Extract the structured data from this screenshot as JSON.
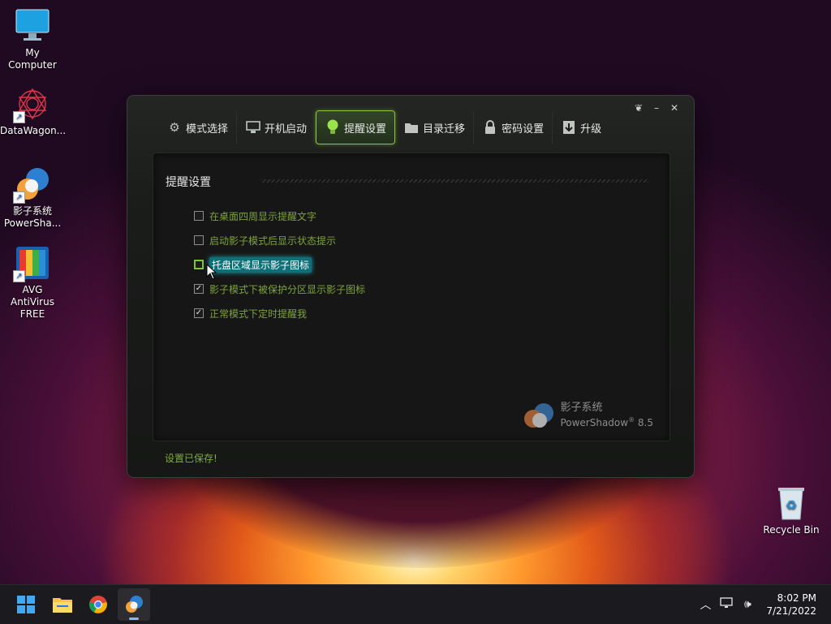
{
  "desktop": {
    "icons": [
      {
        "label": "My Computer",
        "icon": "monitor-icon"
      },
      {
        "label": "DataWagon...",
        "icon": "datawagon-icon"
      },
      {
        "label": "影子系统\nPowerSha...",
        "line1": "影子系统",
        "line2": "PowerSha...",
        "icon": "powershadow-icon"
      },
      {
        "label": "AVG AntiVirus FREE",
        "line1": "AVG AntiVirus",
        "line2": "FREE",
        "icon": "avg-icon"
      },
      {
        "label": "Recycle Bin",
        "icon": "recycle-bin-icon"
      }
    ]
  },
  "app": {
    "tabs": [
      {
        "label": "模式选择",
        "icon": "gear-icon"
      },
      {
        "label": "开机启动",
        "icon": "computer-icon"
      },
      {
        "label": "提醒设置",
        "icon": "lightbulb-icon"
      },
      {
        "label": "目录迁移",
        "icon": "folder-icon"
      },
      {
        "label": "密码设置",
        "icon": "lock-icon"
      },
      {
        "label": "升级",
        "icon": "download-icon"
      }
    ],
    "active_tab": "提醒设置",
    "panel_title": "提醒设置",
    "options": [
      {
        "label": "在桌面四周显示提醒文字",
        "checked": false
      },
      {
        "label": "启动影子模式后显示状态提示",
        "checked": false
      },
      {
        "label": "托盘区域显示影子图标",
        "checked": false,
        "focused": true
      },
      {
        "label": "影子模式下被保护分区显示影子图标",
        "checked": true
      },
      {
        "label": "正常模式下定时提醒我",
        "checked": true
      }
    ],
    "brand": {
      "name_cn": "影子系统",
      "name_en": "PowerShadow",
      "reg": "®",
      "version": "8.5"
    },
    "status": "设置已保存!"
  },
  "taskbar": {
    "apps": [
      "start-icon",
      "file-explorer-icon",
      "chrome-icon",
      "powershadow-icon"
    ],
    "clock": {
      "time": "8:02 PM",
      "date": "7/21/2022"
    }
  }
}
